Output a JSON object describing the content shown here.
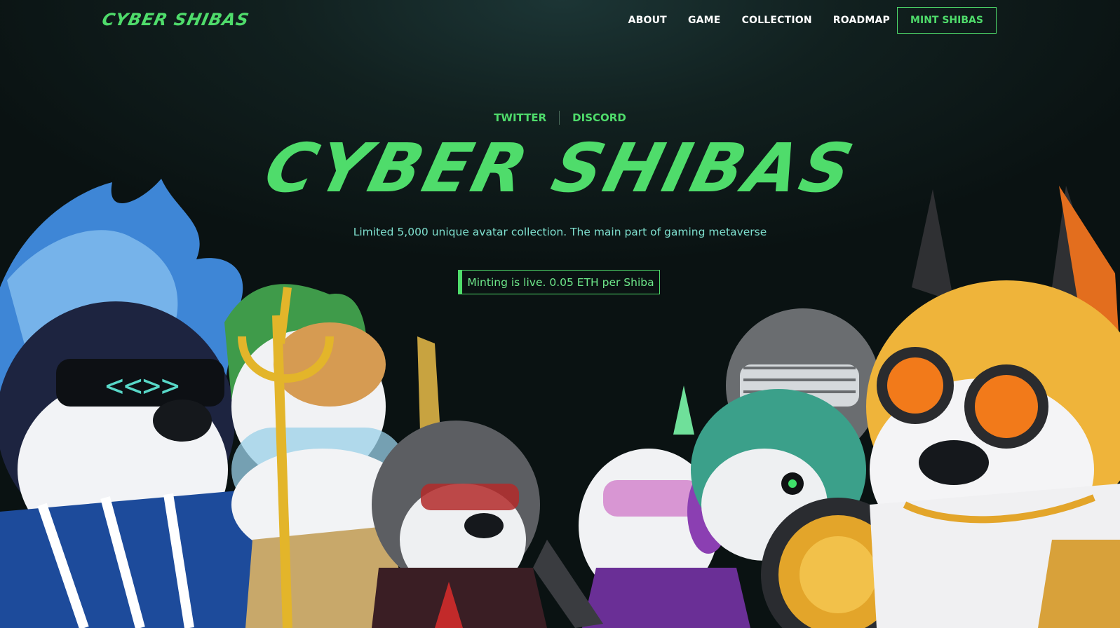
{
  "brand": {
    "logo_text": "CYBER SHIBAS"
  },
  "nav": {
    "links": [
      "ABOUT",
      "GAME",
      "COLLECTION",
      "ROADMAP"
    ],
    "cta_label": "MINT SHIBAS"
  },
  "social": {
    "twitter": "TWITTER",
    "discord": "DISCORD"
  },
  "hero": {
    "title": "CYBER SHIBAS",
    "subtitle": "Limited 5,000 unique avatar collection. The main part of gaming metaverse",
    "status": "Minting is live. 0.05 ETH per Shiba"
  },
  "colors": {
    "accent": "#4fdc6b",
    "subtitle": "#7fe0cf",
    "background": "#0b1414"
  },
  "art": {
    "characters": [
      "blue-flame-shiba",
      "trident-shiba",
      "helmet-shiba",
      "hooded-gray-shiba",
      "purple-headset-shiba",
      "teal-visor-shiba",
      "gray-grille-shiba",
      "orange-goggles-shiba"
    ]
  }
}
